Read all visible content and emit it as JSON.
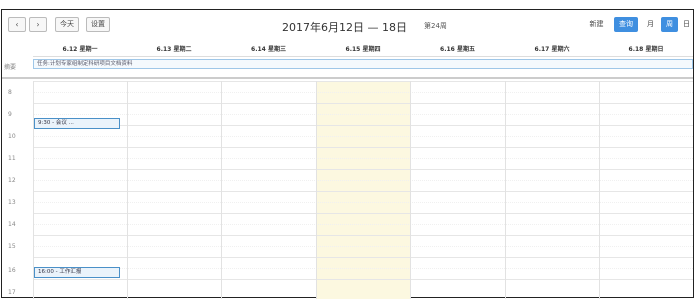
{
  "toolbar": {
    "prev": "‹",
    "next": "›",
    "today": "今天",
    "settings": "设置",
    "title": "2017年6月12日 — 18日",
    "week": "第24周",
    "new": "新建",
    "search": "查询",
    "month": "月",
    "week_view": "周",
    "day": "日"
  },
  "days": [
    "6.12 星期一",
    "6.13 星期二",
    "6.14 星期三",
    "6.15 星期四",
    "6.16 星期五",
    "6.17 星期六",
    "6.18 星期日"
  ],
  "allday": {
    "label": "摘要",
    "event": "任务:计划专家组制定科研项目文档资料"
  },
  "hours": [
    "8",
    "9",
    "10",
    "11",
    "12",
    "13",
    "14",
    "15",
    "16",
    "17"
  ],
  "events": [
    {
      "label": "9:30 - 会议 ..."
    },
    {
      "label": "16:00 - 工作汇报"
    }
  ],
  "colors": {
    "accent": "#3f8fe0",
    "today_bg": "#fcf8e0",
    "event_border": "#4a90c8"
  }
}
